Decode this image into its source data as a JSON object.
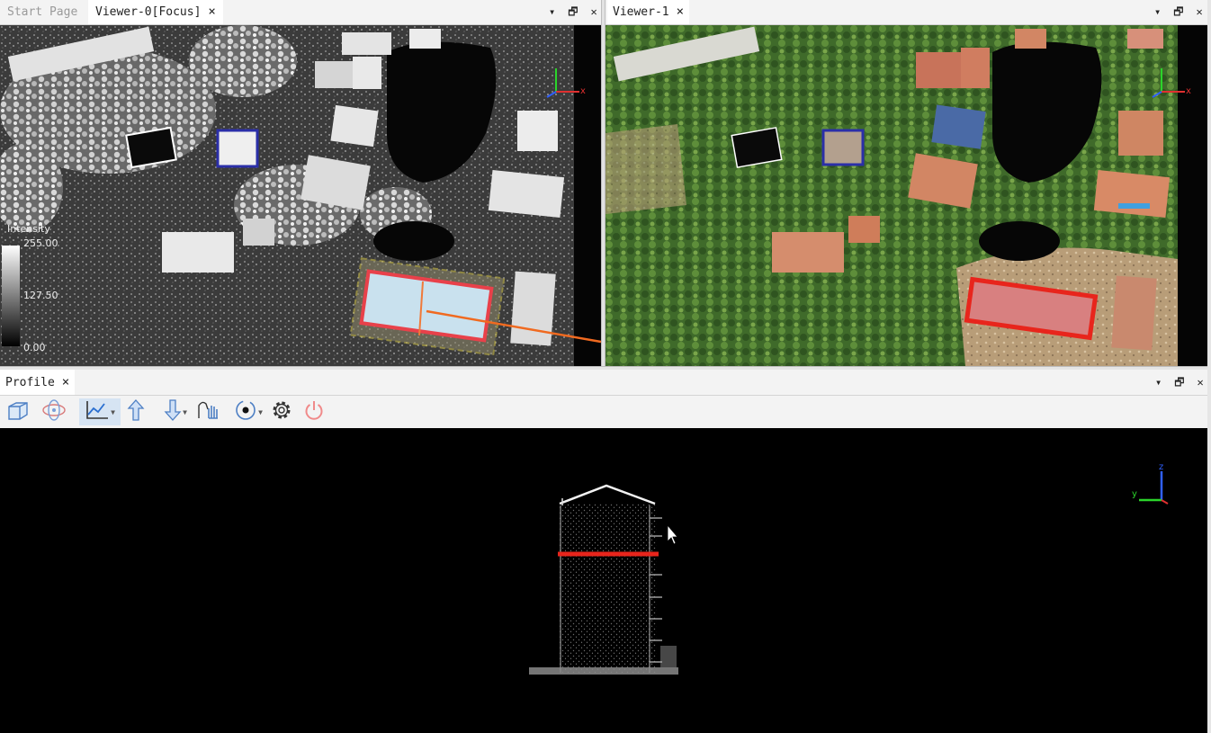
{
  "top_left_panel": {
    "tabs": [
      {
        "label": "Start Page",
        "state": "inactive"
      },
      {
        "label": "Viewer-0[Focus]",
        "state": "active"
      }
    ],
    "close_glyph": "×",
    "controls": [
      "▾",
      "🗗",
      "✕"
    ]
  },
  "top_right_panel": {
    "tabs": [
      {
        "label": "Viewer-1",
        "state": "active"
      }
    ],
    "close_glyph": "×",
    "controls": [
      "▾",
      "🗗",
      "✕"
    ]
  },
  "viewer0": {
    "color_bar": {
      "title": "Intensity",
      "max": "255.00",
      "mid": "127.50",
      "min": "0.00"
    },
    "axis": {
      "x": "x"
    },
    "selection_color": "#e8414a",
    "highlight_color": "#2b2fa8"
  },
  "viewer1": {
    "axis": {
      "x": "x"
    },
    "selection_color": "#e8251c"
  },
  "profile_panel": {
    "tab_label": "Profile",
    "close_glyph": "×",
    "controls": [
      "▾",
      "🗗",
      "✕"
    ],
    "toolbar": [
      {
        "icon": "cube-view-icon"
      },
      {
        "icon": "orbit-icon"
      },
      {
        "icon": "profile-chart-icon",
        "selected": true,
        "has_menu": true
      },
      {
        "icon": "arrow-up-icon"
      },
      {
        "icon": "arrow-down-icon",
        "has_menu": true
      },
      {
        "icon": "pan-hand-icon"
      },
      {
        "icon": "target-point-icon",
        "has_menu": true
      },
      {
        "icon": "settings-gear-icon"
      },
      {
        "icon": "power-icon"
      }
    ],
    "axis": {
      "y": "y",
      "z": "z"
    },
    "cut_line_color": "#e8251c"
  }
}
